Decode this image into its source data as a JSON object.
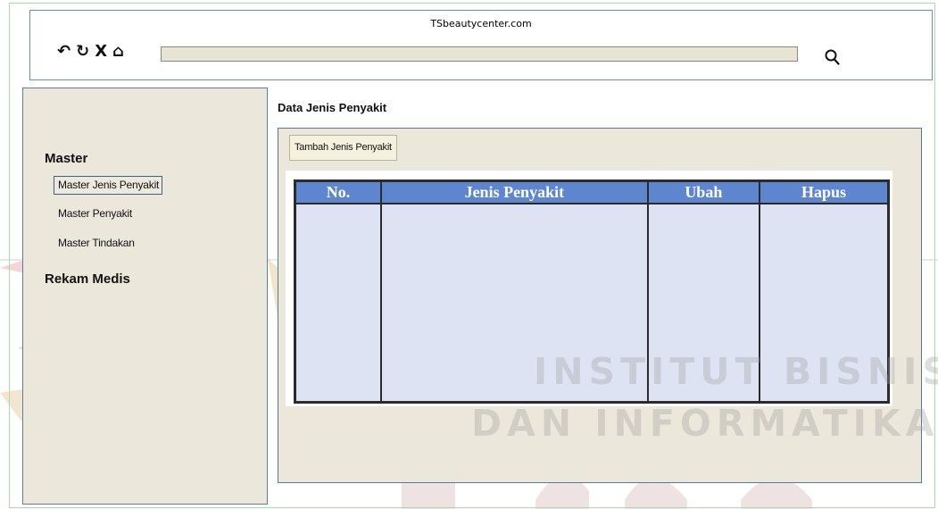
{
  "browser": {
    "site_title": "TSbeautycenter.com",
    "icons": [
      "undo-icon",
      "refresh-icon",
      "close-icon",
      "home-icon",
      "search-icon"
    ],
    "address_value": ""
  },
  "sidebar": {
    "sections": [
      {
        "heading": "Master",
        "items": [
          "Master Jenis Penyakit",
          "Master Penyakit",
          "Master Tindakan"
        ],
        "active_item": "Master Jenis Penyakit"
      },
      {
        "heading": "Rekam Medis",
        "items": []
      }
    ]
  },
  "main": {
    "title": "Data Jenis Penyakit",
    "add_button": "Tambah Jenis Penyakit",
    "table": {
      "columns": [
        "No.",
        "Jenis Penyakit",
        "Ubah",
        "Hapus"
      ],
      "rows": []
    }
  },
  "watermark": [
    "INSTITUT BISNIS",
    "DAN INFORMATIKA"
  ],
  "colors": {
    "panel_bg": "#ebe7da",
    "table_header": "#5d86cf",
    "table_body": "#dee3f3",
    "border_blue": "#4f7aa3"
  }
}
